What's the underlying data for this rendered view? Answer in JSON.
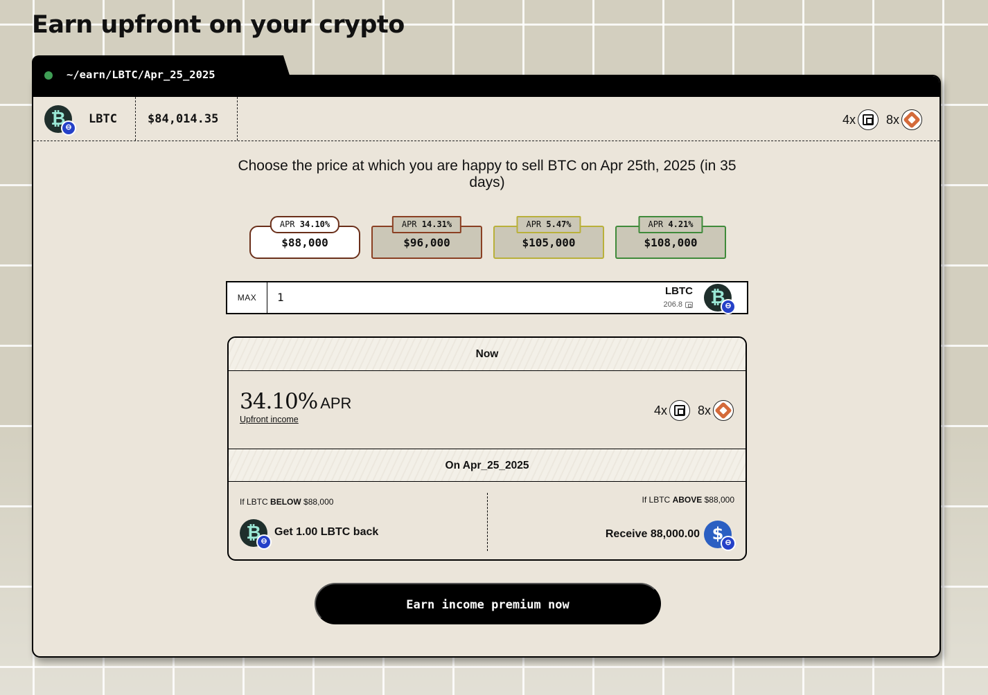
{
  "page": {
    "title": "Earn upfront on your crypto"
  },
  "window": {
    "path": "~/earn/LBTC/Apr_25_2025"
  },
  "asset": {
    "icon": "lbtc-coin-icon",
    "name": "LBTC",
    "price": "$84,014.35",
    "multipliers": [
      {
        "label": "4x",
        "icon": "protocol-black-icon"
      },
      {
        "label": "8x",
        "icon": "protocol-orange-icon"
      }
    ]
  },
  "question": "Choose the price at which you are happy to sell BTC on Apr 25th, 2025 (in 35 days)",
  "strikes": [
    {
      "apr_label": "APR",
      "apr": "34.10%",
      "price": "$88,000",
      "selected": true,
      "color": "#6a2f1a"
    },
    {
      "apr_label": "APR",
      "apr": "14.31%",
      "price": "$96,000",
      "selected": false,
      "color": "#8a3f22"
    },
    {
      "apr_label": "APR",
      "apr": "5.47%",
      "price": "$105,000",
      "selected": false,
      "color": "#b9b03a"
    },
    {
      "apr_label": "APR",
      "apr": "4.21%",
      "price": "$108,000",
      "selected": false,
      "color": "#3f8a3a"
    }
  ],
  "amount": {
    "max_label": "MAX",
    "value": "1",
    "unit": "LBTC",
    "balance": "206.8"
  },
  "summary": {
    "now_label": "Now",
    "apr_value": "34.10%",
    "apr_unit": "APR",
    "upfront_link": "Upfront income",
    "multipliers": [
      {
        "label": "4x",
        "icon": "protocol-black-icon"
      },
      {
        "label": "8x",
        "icon": "protocol-orange-icon"
      }
    ],
    "expiry_label": "On Apr_25_2025",
    "below": {
      "prefix": "If LBTC",
      "keyword": "BELOW",
      "price": "$88,000",
      "result": "Get 1.00 LBTC back"
    },
    "above": {
      "prefix": "If LBTC",
      "keyword": "ABOVE",
      "price": "$88,000",
      "result": "Receive 88,000.00"
    }
  },
  "cta": {
    "label": "Earn income premium now"
  }
}
